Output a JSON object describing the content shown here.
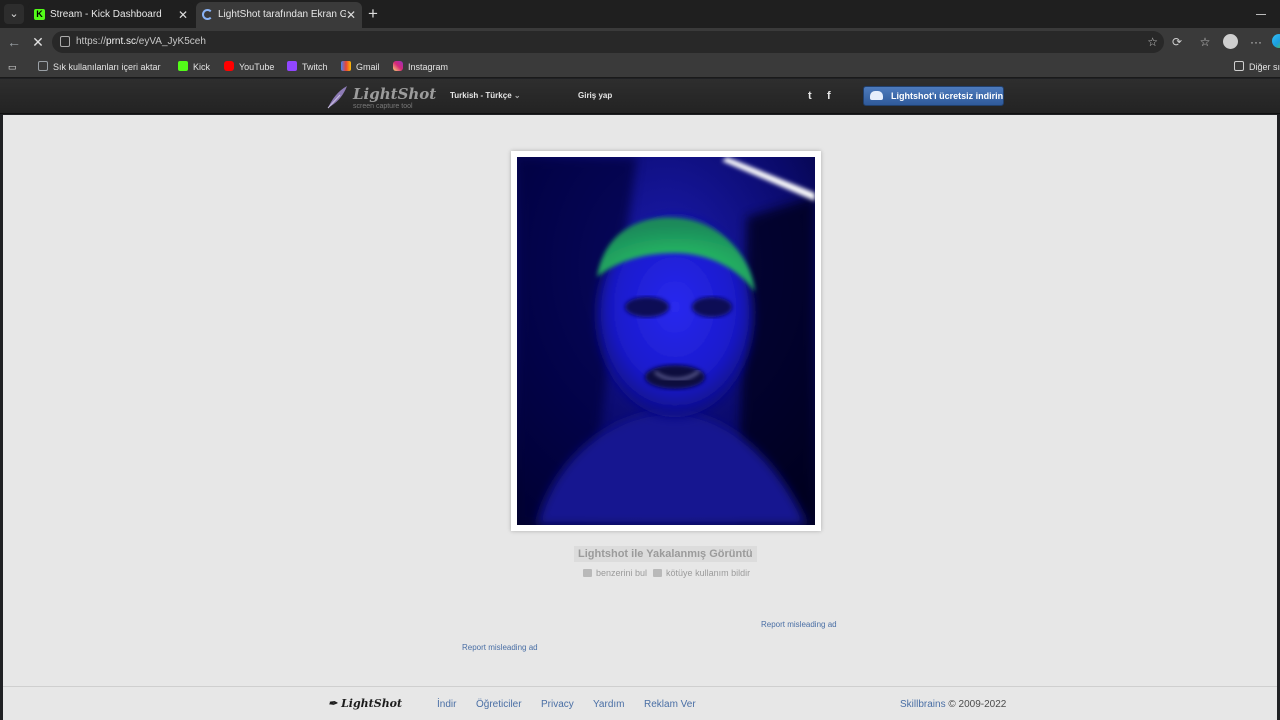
{
  "browser": {
    "tabs": [
      {
        "title": "Stream - Kick Dashboard",
        "active": false
      },
      {
        "title": "LightShot tarafından Ekran Görüntüsü",
        "active": true
      }
    ],
    "url_prefix": "https://",
    "url_host": "prnt.sc",
    "url_path": "/eyVA_JyK5ceh",
    "bookmarks": [
      {
        "label": "Sık kullanılanları içeri aktar",
        "icon": "import-icon",
        "color": "#9aa0a6"
      },
      {
        "label": "Kick",
        "icon": "kick-icon",
        "color": "#53fc18"
      },
      {
        "label": "YouTube",
        "icon": "youtube-icon",
        "color": "#ff0000"
      },
      {
        "label": "Twitch",
        "icon": "twitch-icon",
        "color": "#9146ff"
      },
      {
        "label": "Gmail",
        "icon": "gmail-icon",
        "color": "#ea4335"
      },
      {
        "label": "Instagram",
        "icon": "instagram-icon",
        "color": "#d6249f"
      }
    ],
    "other_bookmarks": "Diğer sık"
  },
  "lightshot": {
    "logo_name": "LightShot",
    "logo_tagline": "screen capture tool",
    "language": "Turkish - Türkçe",
    "login": "Giriş yap",
    "twitter_glyph": "t",
    "facebook_glyph": "f",
    "download_button": "Lightshot'ı ücretsiz indirin",
    "caption": "Lightshot ile Yakalanmış Görüntü",
    "find_similar": "benzerini bul",
    "report_abuse": "kötüye kullanım bildir",
    "report_ad_1": "Report misleading ad",
    "report_ad_2": "Report misleading ad"
  },
  "footer": {
    "logo": "LightShot",
    "links": [
      "İndir",
      "Öğreticiler",
      "Privacy",
      "Yardım",
      "Reklam Ver"
    ],
    "company": "Skillbrains",
    "copyright": "© 2009-2022"
  },
  "colors": {
    "accent_blue": "#4a6fa5",
    "kick_green": "#53fc18",
    "photo_background": "#0a0a5a"
  }
}
